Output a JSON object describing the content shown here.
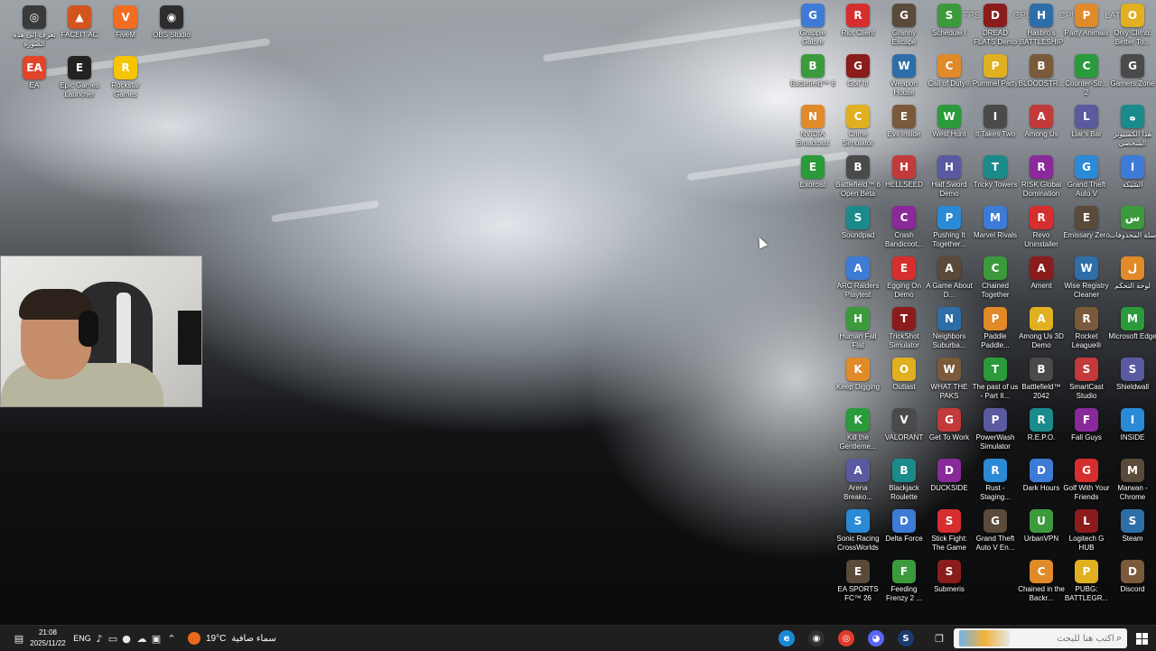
{
  "overlay": {
    "fps": "FPS: N/A",
    "gpu": "GPU: ---",
    "cpu": "CPU: ---",
    "latency": "LAT: N/A"
  },
  "desktop_left": [
    {
      "label": "تعرف إلى هذه الصورة",
      "icon": "windows-spotlight-icon",
      "color": "#3a3a3a",
      "glyph": "◎"
    },
    {
      "label": "FACEIT AC",
      "icon": "faceit-icon",
      "color": "#d2551d",
      "glyph": "▲"
    },
    {
      "label": "FiveM",
      "icon": "fivem-icon",
      "color": "#f26d21",
      "glyph": "V"
    },
    {
      "label": "OBS Studio",
      "icon": "obs-icon",
      "color": "#2d2d2d",
      "glyph": "◉"
    },
    {
      "label": "EA",
      "icon": "ea-icon",
      "color": "#e2442a",
      "glyph": "EA"
    },
    {
      "label": "Epic Games Launcher",
      "icon": "epic-games-icon",
      "color": "#222222",
      "glyph": "E"
    },
    {
      "label": "Rockstar Games",
      "icon": "rockstar-icon",
      "color": "#f6c400",
      "glyph": "R"
    }
  ],
  "desktop_grid": [
    [
      "Grapple Galore",
      "Riot Client",
      "Granny Escape",
      "Schedule I",
      "DREAD FLATS Demo",
      "Hasbro's BATTLESHIP",
      "Party Animals",
      "Only Climb: Better To..."
    ],
    [
      "Battlefield™ 6",
      "Golf It!",
      "Weapon House Simulator",
      "Call of Duty®",
      "Pummel Party",
      "BLOODSTR...",
      "Counter-Str... 2",
      "Gamers Zone"
    ],
    [
      "NVIDIA Broadcast",
      "Crime Simulator",
      "Evil Inside",
      "West Hunt",
      "It Takes Two",
      "Among Us",
      "Liar's Bar",
      "هذا الكمبيوتر الشخصي"
    ],
    [
      "Exorcist",
      "Battlefield™ 6 Open Beta",
      "HELLSEED",
      "Half Sword Demo",
      "Tricky Towers",
      "RISK Global Domination",
      "Grand Theft Auto V",
      "الشبكة"
    ],
    [
      "",
      "Soundpad",
      "Crash Bandicoot...",
      "Pushing It Together...",
      "Marvel Rivals",
      "Revo Uninstaller",
      "Emissary Zero",
      "سلة المحذوفات"
    ],
    [
      "",
      "ARC Raiders Playtest",
      "Egging On Demo",
      "A Game About D...",
      "Chained Together",
      "Ament",
      "Wise Registry Cleaner",
      "لوحة التحكم"
    ],
    [
      "",
      "Human Fall Flat",
      "TrickShot Simulator",
      "Neighbors Suburba...",
      "Paddle Paddle...",
      "Among Us 3D Demo",
      "Rocket League®",
      "Microsoft Edge"
    ],
    [
      "",
      "Keep Digging",
      "Outlast",
      "WHAT THE PAKS",
      "The past of us - Part II...",
      "Battlefield™ 2042",
      "SmartCast Studio",
      "Shieldwall"
    ],
    [
      "",
      "Kill the Gentleme...",
      "VALORANT",
      "Get To Work",
      "PowerWash Simulator",
      "R.E.P.O.",
      "Fall Guys",
      "INSIDE"
    ],
    [
      "",
      "Arena Breako...",
      "Blackjack Roulette",
      "DUCKSIDE",
      "Rust - Staging...",
      "Dark Hours",
      "Golf With Your Friends",
      "Marwan - Chrome"
    ],
    [
      "",
      "Sonic Racing CrossWorlds",
      "Delta Force",
      "Stick Fight: The Game",
      "Grand Theft Auto V En...",
      "UrbanVPN",
      "Logitech G HUB",
      "Steam"
    ],
    [
      "",
      "EA SPORTS FC™ 26",
      "Feeding Frenzy 2 ...",
      "Submeris",
      "",
      "Chained in the Backr...",
      "PUBG: BATTLEGR...",
      "Discord"
    ]
  ],
  "grid_colors": [
    "#3d7bd6",
    "#d62e2e",
    "#5a4a3a",
    "#3c9a3c",
    "#8a1c1c",
    "#2e6ea8",
    "#e08a2a",
    "#e0b020",
    "#7a5a3a",
    "#2a9a3a",
    "#4a4a4a",
    "#c23a3a",
    "#5a5aa0",
    "#1a8a8a",
    "#8a2a9a",
    "#2a8ad6"
  ],
  "taskbar": {
    "search_placeholder": "اكتب هنا للبحث",
    "weather_temp": "19°C",
    "weather_desc": "سماء صافية",
    "lang": "ENG",
    "time": "21:08",
    "date": "2025/11/22",
    "pinned": [
      {
        "name": "edge-taskbar-icon",
        "color": "#1b8ad6",
        "glyph": "e"
      },
      {
        "name": "obs-taskbar-icon",
        "color": "#303030",
        "glyph": "◉"
      },
      {
        "name": "chrome-taskbar-icon",
        "color": "#de3b2b",
        "glyph": "◎"
      },
      {
        "name": "discord-taskbar-icon",
        "color": "#5865f2",
        "glyph": "◕"
      },
      {
        "name": "steam-taskbar-icon",
        "color": "#1b3b6f",
        "glyph": "S"
      }
    ]
  }
}
